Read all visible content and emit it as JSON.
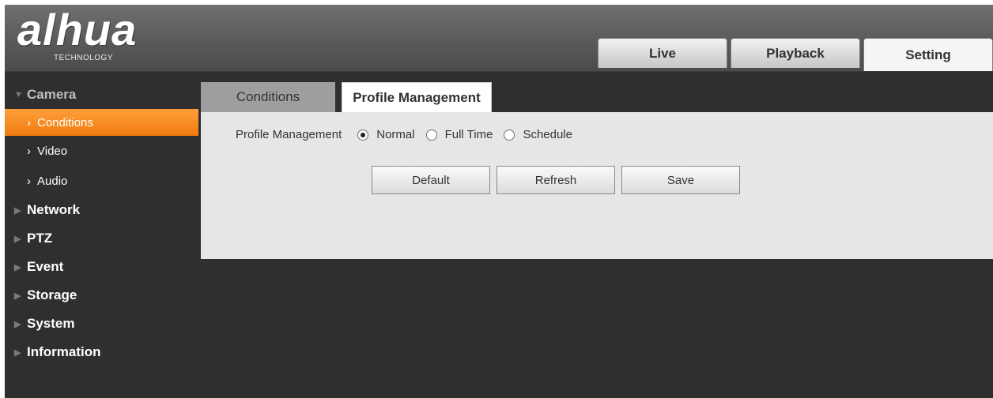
{
  "brand": {
    "logo_text": "alhua",
    "logo_sub": "TECHNOLOGY"
  },
  "top_tabs": [
    {
      "label": "Live"
    },
    {
      "label": "Playback"
    },
    {
      "label": "Setting"
    }
  ],
  "sidebar": {
    "groups": [
      {
        "label": "Camera",
        "expanded": true,
        "items": [
          {
            "label": "Conditions",
            "active": true
          },
          {
            "label": "Video"
          },
          {
            "label": "Audio"
          }
        ]
      },
      {
        "label": "Network"
      },
      {
        "label": "PTZ"
      },
      {
        "label": "Event"
      },
      {
        "label": "Storage"
      },
      {
        "label": "System"
      },
      {
        "label": "Information"
      }
    ]
  },
  "sub_tabs": [
    {
      "label": "Conditions"
    },
    {
      "label": "Profile Management"
    }
  ],
  "form": {
    "field_label": "Profile Management",
    "options": [
      {
        "label": "Normal",
        "selected": true
      },
      {
        "label": "Full Time",
        "selected": false
      },
      {
        "label": "Schedule",
        "selected": false
      }
    ]
  },
  "buttons": {
    "default": "Default",
    "refresh": "Refresh",
    "save": "Save"
  }
}
